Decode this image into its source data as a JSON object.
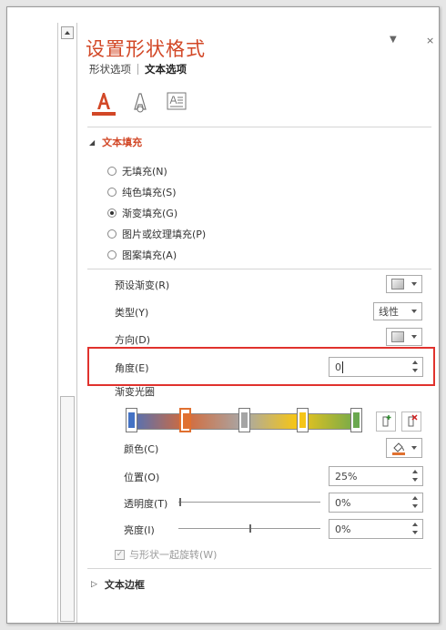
{
  "pane": {
    "title": "设置形状格式",
    "menu_glyph": "▼",
    "close_glyph": "×"
  },
  "tabs": [
    {
      "label": "形状选项",
      "active": false
    },
    {
      "label": "文本选项",
      "active": true
    }
  ],
  "icons": [
    "text-fill-outline-icon",
    "text-effects-icon",
    "text-box-icon"
  ],
  "text_fill": {
    "heading": "文本填充",
    "options": [
      {
        "label": "无填充(N)",
        "checked": false
      },
      {
        "label": "纯色填充(S)",
        "checked": false
      },
      {
        "label": "渐变填充(G)",
        "checked": true
      },
      {
        "label": "图片或纹理填充(P)",
        "checked": false
      },
      {
        "label": "图案填充(A)",
        "checked": false
      }
    ],
    "preset_label": "预设渐变(R)",
    "type_label": "类型(Y)",
    "type_value": "线性",
    "direction_label": "方向(D)",
    "angle_label": "角度(E)",
    "angle_value": "0",
    "stops_label": "渐变光圈",
    "color_label": "颜色(C)",
    "position_label": "位置(O)",
    "position_value": "25%",
    "transparency_label": "透明度(T)",
    "transparency_value": "0%",
    "brightness_label": "亮度(I)",
    "brightness_value": "0%",
    "rotate_label": "与形状一起旋转(W)",
    "rotate_checked": true
  },
  "gradient_stops": [
    {
      "position": 0.02,
      "color": "#4472c4",
      "selected": false
    },
    {
      "position": 0.25,
      "color": "#e07030",
      "selected": true
    },
    {
      "position": 0.5,
      "color": "#a5a5a5",
      "selected": false
    },
    {
      "position": 0.75,
      "color": "#f5c518",
      "selected": false
    },
    {
      "position": 0.98,
      "color": "#6aa84f",
      "selected": false
    }
  ],
  "text_border": {
    "heading": "文本边框"
  },
  "colors": {
    "accent": "#d24726",
    "highlight": "#e0322d"
  }
}
